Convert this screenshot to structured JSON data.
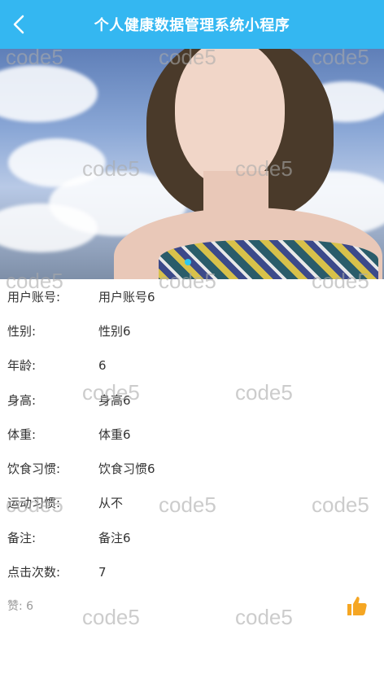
{
  "header": {
    "title": "个人健康数据管理系统小程序"
  },
  "watermark_text": "code5",
  "fields": [
    {
      "label": "用户账号:",
      "value": "用户账号6"
    },
    {
      "label": "性别:",
      "value": "性别6"
    },
    {
      "label": "年龄:",
      "value": "6"
    },
    {
      "label": "身高:",
      "value": "身高6"
    },
    {
      "label": "体重:",
      "value": "体重6"
    },
    {
      "label": "饮食习惯:",
      "value": "饮食习惯6"
    },
    {
      "label": "运动习惯:",
      "value": "从不"
    },
    {
      "label": "备注:",
      "value": "备注6"
    },
    {
      "label": "点击次数:",
      "value": "7"
    }
  ],
  "likes": {
    "text": "赞: 6"
  },
  "colors": {
    "header_bg": "#34b7f1",
    "thumb": "#f5a623"
  },
  "icons": {
    "back": "chevron-left-icon",
    "like": "thumbs-up-icon"
  }
}
